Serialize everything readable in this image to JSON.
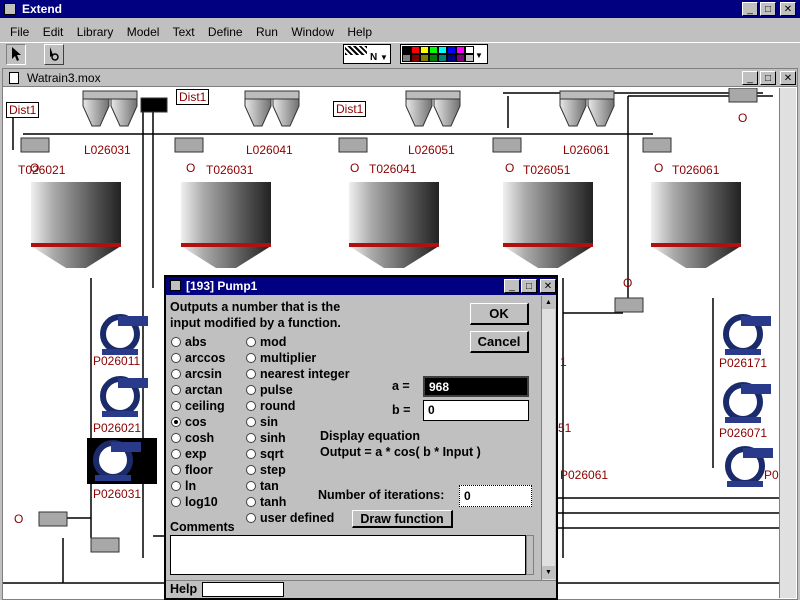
{
  "app": {
    "title": "Extend"
  },
  "menu": [
    "File",
    "Edit",
    "Library",
    "Model",
    "Text",
    "Define",
    "Run",
    "Window",
    "Help"
  ],
  "toolbar": {
    "pattern_label": "N",
    "palette": [
      "#000000",
      "#ff0000",
      "#ffff00",
      "#00ff00",
      "#00ffff",
      "#0000ff",
      "#ff00ff",
      "#ffffff",
      "#808080",
      "#800000",
      "#808000",
      "#008000",
      "#008080",
      "#000080",
      "#800080",
      "#c0c0c0"
    ]
  },
  "model_window": {
    "title": "Watrain3.mox"
  },
  "model": {
    "dist_labels": [
      "Dist1",
      "Dist1",
      "Dist1"
    ],
    "l_labels": [
      "L026031",
      "L026041",
      "L026051",
      "L026061"
    ],
    "t_labels": [
      "T026021",
      "T026031",
      "T026041",
      "T026051",
      "T026061"
    ],
    "o_marks": [
      "O",
      "O",
      "O",
      "O",
      "O",
      "O",
      "O",
      "O"
    ],
    "p_labels_left": [
      "P026011",
      "P026021",
      "P026031"
    ],
    "p_labels_right": [
      "P026171",
      "P026071",
      "P0"
    ],
    "partial_labels": [
      "1",
      "51",
      "P026061"
    ]
  },
  "dialog": {
    "title": "[193]   Pump1",
    "description_line1": "Outputs a number that is the",
    "description_line2": "input modified by a function.",
    "ok": "OK",
    "cancel": "Cancel",
    "functions_col1": [
      "abs",
      "arccos",
      "arcsin",
      "arctan",
      "ceiling",
      "cos",
      "cosh",
      "exp",
      "floor",
      "ln",
      "log10"
    ],
    "functions_col2": [
      "mod",
      "multiplier",
      "nearest integer",
      "pulse",
      "round",
      "sin",
      "sinh",
      "sqrt",
      "step",
      "tan",
      "tanh",
      "user defined"
    ],
    "selected_function": "cos",
    "a_label": "a =",
    "a_value": "968",
    "b_label": "b =",
    "b_value": "0",
    "display_equation_label": "Display equation",
    "equation": "Output = a * cos( b * Input )",
    "iterations_label": "Number of iterations:",
    "iterations_value": "0",
    "draw_function": "Draw function",
    "comments_label": "Comments",
    "help": "Help"
  }
}
